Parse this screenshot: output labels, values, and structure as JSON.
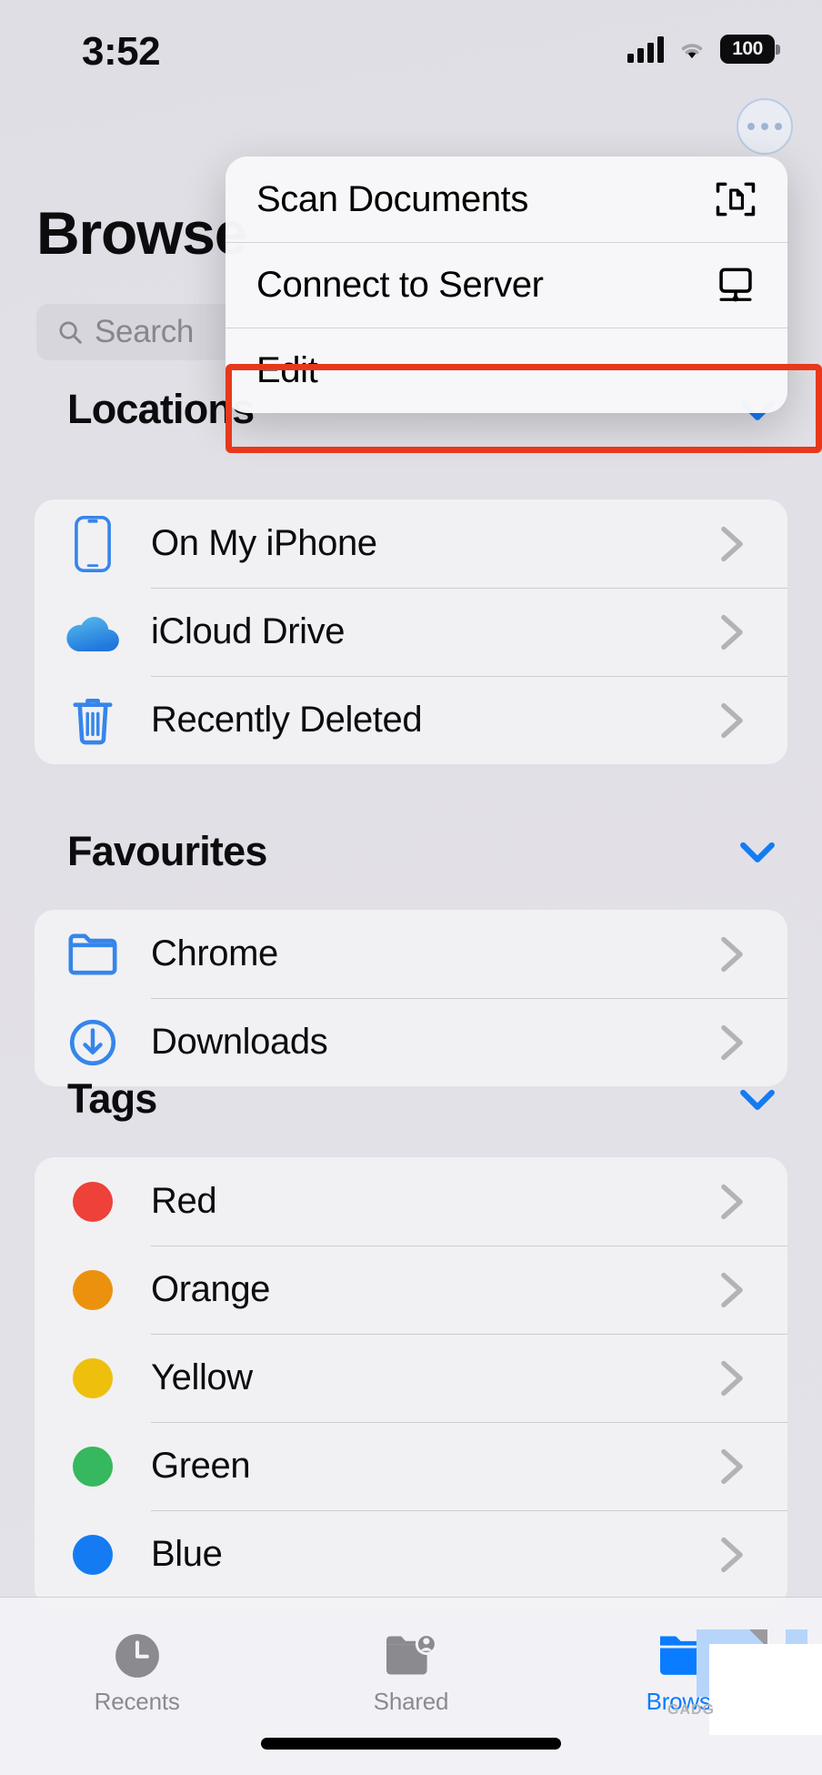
{
  "status_bar": {
    "time": "3:52",
    "battery_level": "100",
    "cellular_icon": "cellular-bars-icon",
    "wifi_icon": "wifi-icon",
    "battery_icon": "battery-full-icon"
  },
  "header": {
    "title": "Browse",
    "more_button_icon": "ellipsis-circle-icon"
  },
  "search": {
    "placeholder": "Search",
    "value": "",
    "icon": "search-icon"
  },
  "popup_menu": {
    "items": [
      {
        "label": "Scan Documents",
        "icon": "document-scanner-icon"
      },
      {
        "label": "Connect to Server",
        "icon": "display-monitor-icon"
      },
      {
        "label": "Edit",
        "icon": ""
      }
    ],
    "highlighted_item": "Edit",
    "highlight_color": "#e8381b"
  },
  "sections": [
    {
      "title": "Locations",
      "collapse_icon": "chevron-down-icon",
      "rows": [
        {
          "label": "On My iPhone",
          "icon": "iphone-icon",
          "icon_color": "#2f87f7",
          "accessory": "chevron-right-icon"
        },
        {
          "label": "iCloud Drive",
          "icon": "icloud-cloud-icon",
          "icon_color": "#3ea9f5",
          "accessory": "chevron-right-icon"
        },
        {
          "label": "Recently Deleted",
          "icon": "trash-icon",
          "icon_color": "#2f87f7",
          "accessory": "chevron-right-icon"
        }
      ]
    },
    {
      "title": "Favourites",
      "collapse_icon": "chevron-down-icon",
      "rows": [
        {
          "label": "Chrome",
          "icon": "folder-outline-icon",
          "icon_color": "#2f87f7",
          "accessory": "chevron-right-icon"
        },
        {
          "label": "Downloads",
          "icon": "download-circle-icon",
          "icon_color": "#2f87f7",
          "accessory": "chevron-right-icon"
        }
      ]
    },
    {
      "title": "Tags",
      "collapse_icon": "chevron-down-icon",
      "rows": [
        {
          "label": "Red",
          "icon": "color-dot",
          "icon_color": "#fb3b30",
          "accessory": "chevron-right-icon"
        },
        {
          "label": "Orange",
          "icon": "color-dot",
          "icon_color": "#fa9500",
          "accessory": "chevron-right-icon"
        },
        {
          "label": "Yellow",
          "icon": "color-dot",
          "icon_color": "#fdc800",
          "accessory": "chevron-right-icon"
        },
        {
          "label": "Green",
          "icon": "color-dot",
          "icon_color": "#2ec05a",
          "accessory": "chevron-right-icon"
        },
        {
          "label": "Blue",
          "icon": "color-dot",
          "icon_color": "#0a7cff",
          "accessory": "chevron-right-icon"
        }
      ]
    }
  ],
  "tab_bar": {
    "tabs": [
      {
        "label": "Recents",
        "icon": "clock-icon",
        "active": false
      },
      {
        "label": "Shared",
        "icon": "folder-person-icon",
        "active": false
      },
      {
        "label": "Browse",
        "icon": "folder-filled-icon",
        "active": true
      }
    ],
    "active_color": "#0a7cff",
    "inactive_color": "#8a8a8f"
  },
  "watermark": {
    "text": "GADG"
  }
}
